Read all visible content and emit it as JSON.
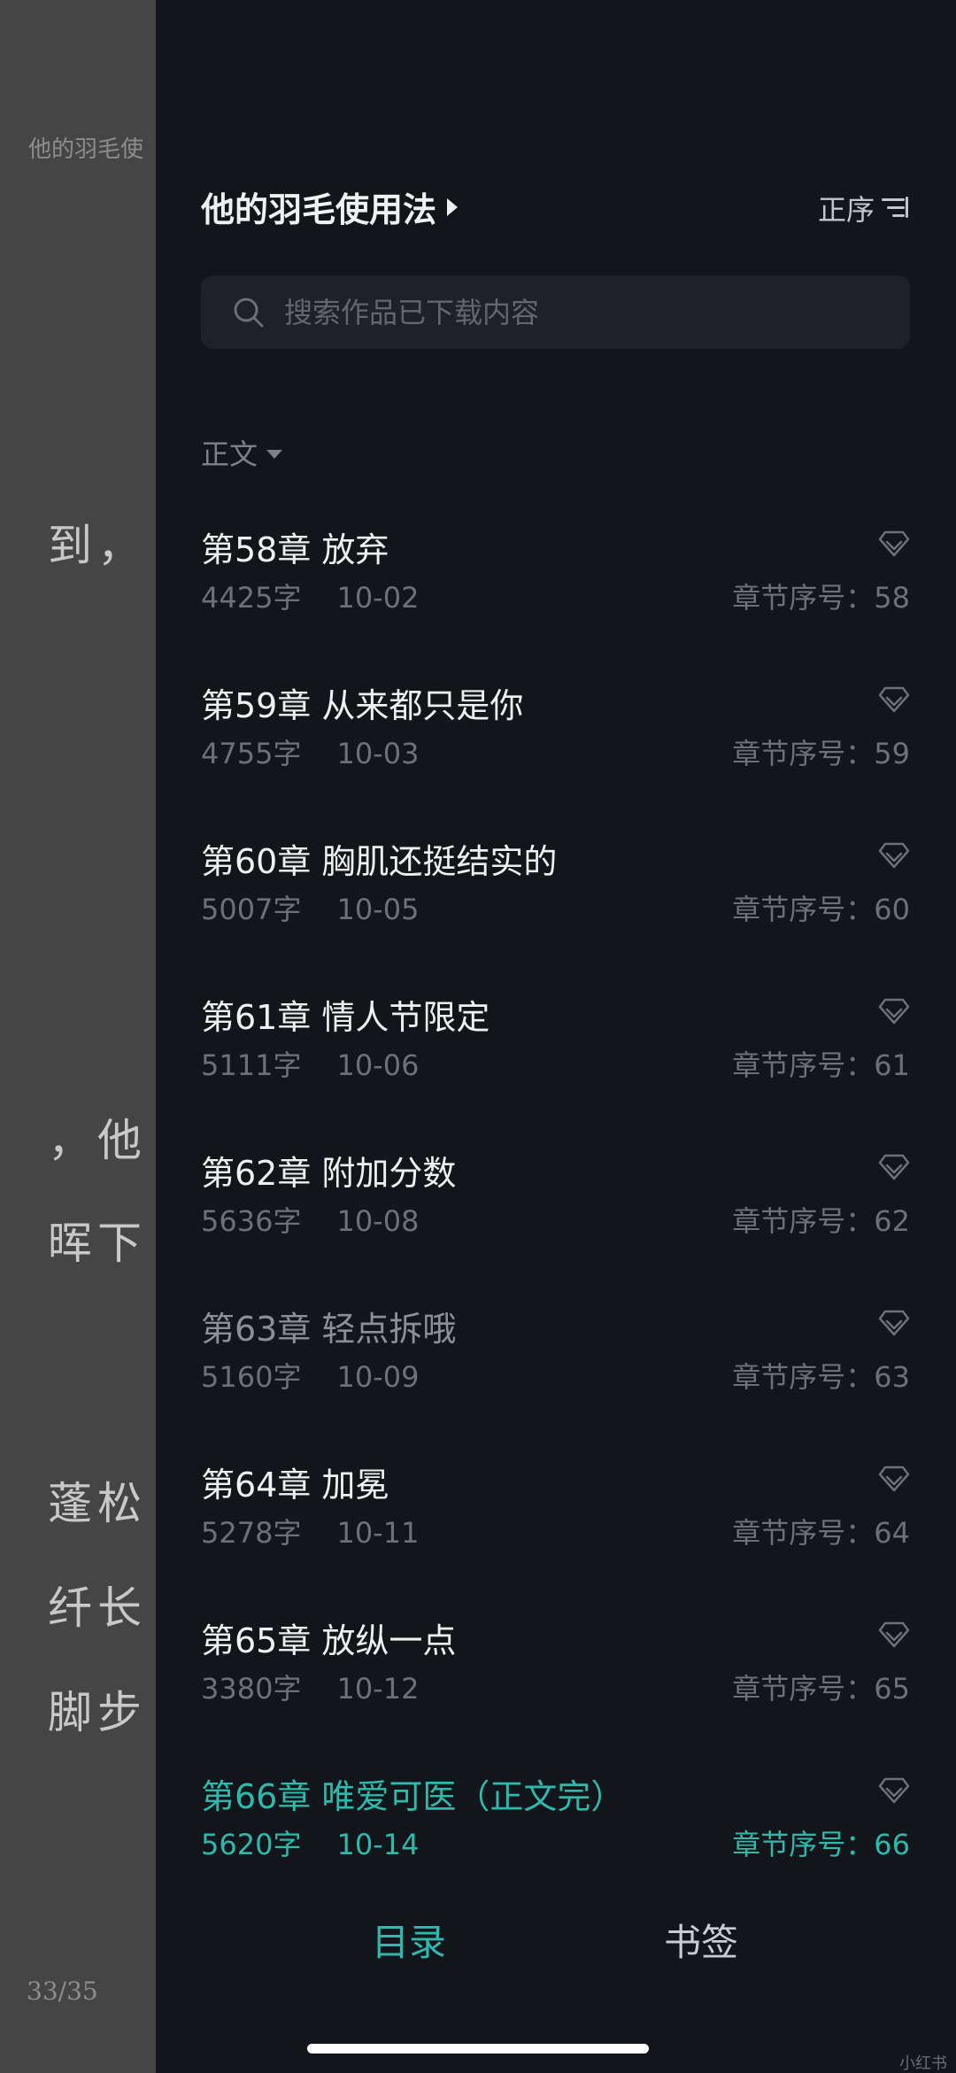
{
  "reader": {
    "header_title": "他的羽毛使",
    "lines": [
      "到，",
      "，他",
      "晖下",
      "蓬松",
      "纤长",
      "脚步"
    ],
    "page_indicator": "33/35"
  },
  "drawer": {
    "book_title": "他的羽毛使用法",
    "sort_label": "正序",
    "search_placeholder": "搜索作品已下载内容",
    "section_label": "正文",
    "accent_color": "#2fb9ad",
    "chapters": [
      {
        "title": "第58章 放弃",
        "words": "4425字",
        "date": "10-02",
        "seq": "章节序号：58",
        "state": "normal"
      },
      {
        "title": "第59章 从来都只是你",
        "words": "4755字",
        "date": "10-03",
        "seq": "章节序号：59",
        "state": "normal"
      },
      {
        "title": "第60章 胸肌还挺结实的",
        "words": "5007字",
        "date": "10-05",
        "seq": "章节序号：60",
        "state": "normal"
      },
      {
        "title": "第61章 情人节限定",
        "words": "5111字",
        "date": "10-06",
        "seq": "章节序号：61",
        "state": "normal"
      },
      {
        "title": "第62章 附加分数",
        "words": "5636字",
        "date": "10-08",
        "seq": "章节序号：62",
        "state": "normal"
      },
      {
        "title": "第63章 轻点拆哦",
        "words": "5160字",
        "date": "10-09",
        "seq": "章节序号：63",
        "state": "read"
      },
      {
        "title": "第64章 加冕",
        "words": "5278字",
        "date": "10-11",
        "seq": "章节序号：64",
        "state": "normal"
      },
      {
        "title": "第65章 放纵一点",
        "words": "3380字",
        "date": "10-12",
        "seq": "章节序号：65",
        "state": "normal"
      },
      {
        "title": "第66章 唯爱可医（正文完）",
        "words": "5620字",
        "date": "10-14",
        "seq": "章节序号：66",
        "state": "current"
      }
    ],
    "tabs": {
      "toc": "目录",
      "bookmarks": "书签"
    }
  },
  "watermark": "小红书"
}
